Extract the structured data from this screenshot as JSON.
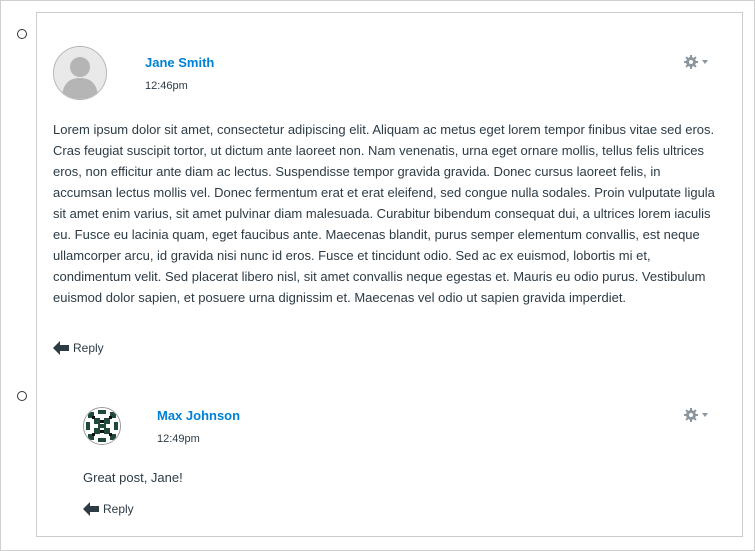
{
  "posts": [
    {
      "author": "Jane Smith",
      "time": "12:46pm",
      "message": "Lorem ipsum dolor sit amet, consectetur adipiscing elit. Aliquam ac metus eget lorem tempor finibus vitae sed eros. Cras feugiat suscipit tortor, ut dictum ante laoreet non. Nam venenatis, urna eget ornare mollis, tellus felis ultrices eros, non efficitur ante diam ac lectus. Suspendisse tempor gravida gravida. Donec cursus laoreet felis, in accumsan lectus mollis vel. Donec fermentum erat et erat eleifend, sed congue nulla sodales. Proin vulputate ligula sit amet enim varius, sit amet pulvinar diam malesuada. Curabitur bibendum consequat dui, a ultrices lorem iaculis eu. Fusce eu lacinia quam, eget faucibus ante. Maecenas blandit, purus semper elementum convallis, est neque ullamcorper arcu, id gravida nisi nunc id eros. Fusce et tincidunt odio. Sed ac ex euismod, lobortis mi et, condimentum velit. Sed placerat libero nisl, sit amet convallis neque egestas et. Mauris eu odio purus. Vestibulum euismod dolor sapien, et posuere urna dignissim et. Maecenas vel odio ut sapien gravida imperdiet.",
      "reply_label": "Reply",
      "avatar_icon": "default-user-avatar-icon",
      "menu_icon": "gear-icon"
    },
    {
      "author": "Max Johnson",
      "time": "12:49pm",
      "message": "Great post, Jane!",
      "reply_label": "Reply",
      "avatar_icon": "patterned-user-avatar-icon",
      "menu_icon": "gear-icon"
    }
  ],
  "colors": {
    "author_link": "#0081d6",
    "text": "#2d3b45",
    "border": "#c7cdd1",
    "icon_gray": "#8b969e"
  }
}
